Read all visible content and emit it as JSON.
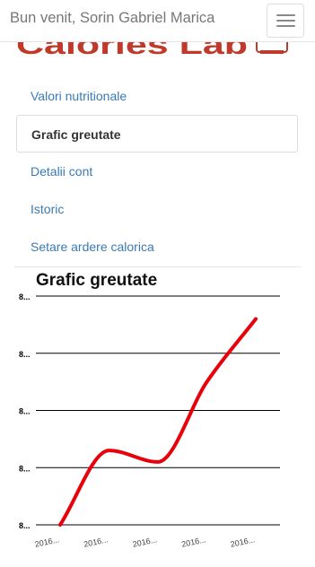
{
  "header": {
    "welcome_text": "Bun venit, Sorin Gabriel Marica",
    "menu_icon": "hamburger-menu-icon",
    "logo_text": "Calories Lab",
    "logo_icon": "scale-icon",
    "brand_color": "#c0392b"
  },
  "nav": {
    "items": [
      {
        "label": "Valori nutritionale"
      },
      {
        "label": "Grafic greutate",
        "active": true
      },
      {
        "label": "Detalii cont"
      },
      {
        "label": "Istoric"
      },
      {
        "label": "Setare ardere calorica"
      }
    ],
    "link_color": "#3a7ab4"
  },
  "chart_data": {
    "type": "line",
    "title": "Grafic greutate",
    "y_tick_labels": [
      "8...",
      "8...",
      "8...",
      "8...",
      "8..."
    ],
    "categories": [
      "2016...",
      "2016...",
      "2016...",
      "2016...",
      "2016..."
    ],
    "series": [
      {
        "values": [
          0.0,
          1.3,
          1.1,
          2.5,
          3.6
        ],
        "color": "#e8000b"
      }
    ],
    "ylim": [
      0,
      4
    ],
    "grid": true,
    "legend": "none"
  }
}
